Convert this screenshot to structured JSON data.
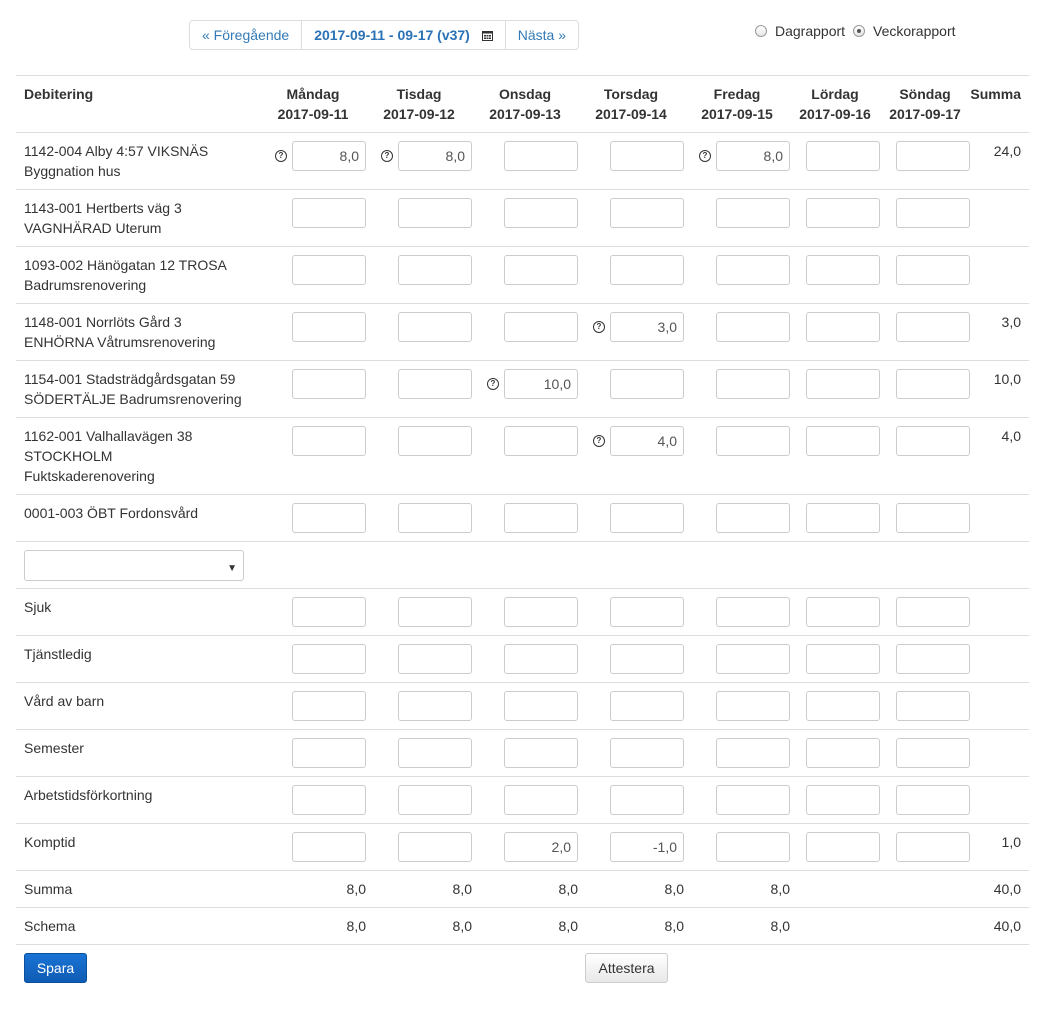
{
  "nav": {
    "prev": "« Föregående",
    "current": "2017-09-11 - 09-17 (v37)",
    "next": "Nästa »"
  },
  "mode": {
    "day": "Dagrapport",
    "week": "Veckorapport",
    "selected": "week"
  },
  "header": {
    "debitering": "Debitering",
    "summa": "Summa",
    "days": [
      {
        "name": "Måndag",
        "date": "2017-09-11"
      },
      {
        "name": "Tisdag",
        "date": "2017-09-12"
      },
      {
        "name": "Onsdag",
        "date": "2017-09-13"
      },
      {
        "name": "Torsdag",
        "date": "2017-09-14"
      },
      {
        "name": "Fredag",
        "date": "2017-09-15"
      },
      {
        "name": "Lördag",
        "date": "2017-09-16"
      },
      {
        "name": "Söndag",
        "date": "2017-09-17"
      }
    ]
  },
  "projects": [
    {
      "label": [
        "1142-004 Alby 4:57 VIKSNÄS",
        "Byggnation hus"
      ],
      "values": [
        "8,0",
        "8,0",
        "",
        "",
        "8,0",
        "",
        ""
      ],
      "help": [
        true,
        true,
        false,
        false,
        true,
        false,
        false
      ],
      "sum": "24,0"
    },
    {
      "label": [
        "1143-001 Hertberts väg 3",
        "VAGNHÄRAD Uterum"
      ],
      "values": [
        "",
        "",
        "",
        "",
        "",
        "",
        ""
      ],
      "help": [
        false,
        false,
        false,
        false,
        false,
        false,
        false
      ],
      "sum": ""
    },
    {
      "label": [
        "1093-002 Hänögatan 12 TROSA",
        "Badrumsrenovering"
      ],
      "values": [
        "",
        "",
        "",
        "",
        "",
        "",
        ""
      ],
      "help": [
        false,
        false,
        false,
        false,
        false,
        false,
        false
      ],
      "sum": ""
    },
    {
      "label": [
        "1148-001 Norrlöts Gård 3",
        "ENHÖRNA Våtrumsrenovering"
      ],
      "values": [
        "",
        "",
        "",
        "3,0",
        "",
        "",
        ""
      ],
      "help": [
        false,
        false,
        false,
        true,
        false,
        false,
        false
      ],
      "sum": "3,0"
    },
    {
      "label": [
        "1154-001 Stadsträdgårdsgatan 59",
        "SÖDERTÄLJE Badrumsrenovering"
      ],
      "values": [
        "",
        "",
        "10,0",
        "",
        "",
        "",
        ""
      ],
      "help": [
        false,
        false,
        true,
        false,
        false,
        false,
        false
      ],
      "sum": "10,0"
    },
    {
      "label": [
        "1162-001 Valhallavägen 38",
        "STOCKHOLM",
        "Fuktskaderenovering"
      ],
      "values": [
        "",
        "",
        "",
        "4,0",
        "",
        "",
        ""
      ],
      "help": [
        false,
        false,
        false,
        true,
        false,
        false,
        false
      ],
      "sum": "4,0"
    },
    {
      "label": [
        "0001-003 ÖBT Fordonsvård"
      ],
      "values": [
        "",
        "",
        "",
        "",
        "",
        "",
        ""
      ],
      "help": [
        false,
        false,
        false,
        false,
        false,
        false,
        false
      ],
      "sum": ""
    }
  ],
  "absence": [
    {
      "label": "Sjuk",
      "values": [
        "",
        "",
        "",
        "",
        "",
        "",
        ""
      ],
      "sum": ""
    },
    {
      "label": "Tjänstledig",
      "values": [
        "",
        "",
        "",
        "",
        "",
        "",
        ""
      ],
      "sum": ""
    },
    {
      "label": "Vård av barn",
      "values": [
        "",
        "",
        "",
        "",
        "",
        "",
        ""
      ],
      "sum": ""
    },
    {
      "label": "Semester",
      "values": [
        "",
        "",
        "",
        "",
        "",
        "",
        ""
      ],
      "sum": ""
    },
    {
      "label": "Arbetstidsförkortning",
      "values": [
        "",
        "",
        "",
        "",
        "",
        "",
        ""
      ],
      "sum": ""
    },
    {
      "label": "Komptid",
      "values": [
        "",
        "",
        "2,0",
        "-1,0",
        "",
        "",
        ""
      ],
      "sum": "1,0"
    }
  ],
  "totals": [
    {
      "label": "Summa",
      "values": [
        "8,0",
        "8,0",
        "8,0",
        "8,0",
        "8,0",
        "",
        ""
      ],
      "sum": "40,0"
    },
    {
      "label": "Schema",
      "values": [
        "8,0",
        "8,0",
        "8,0",
        "8,0",
        "8,0",
        "",
        ""
      ],
      "sum": "40,0"
    }
  ],
  "buttons": {
    "save": "Spara",
    "attest": "Attestera"
  },
  "colors": {
    "link": "#337ab7",
    "primary": "#0f5cb4",
    "border": "#dddddd"
  }
}
